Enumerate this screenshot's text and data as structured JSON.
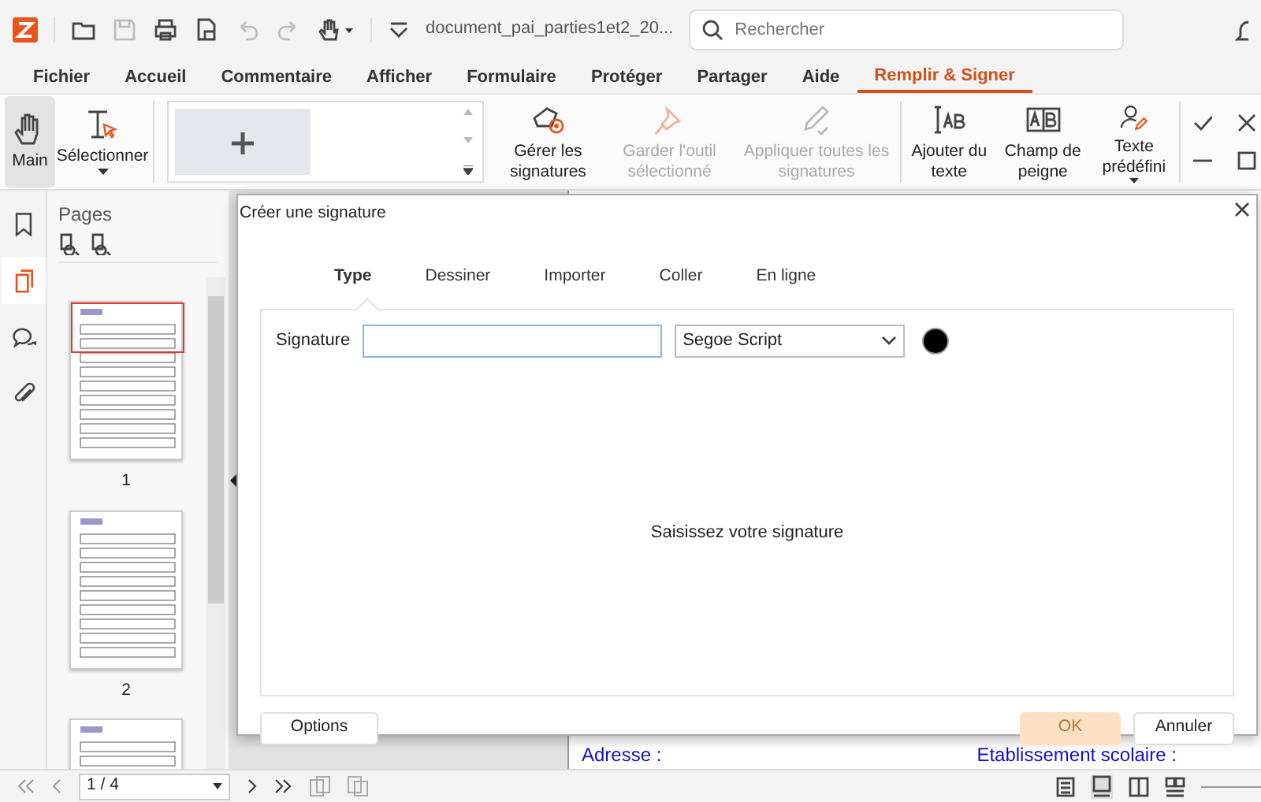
{
  "titlebar": {
    "filename": "document_pai_parties1et2_20...",
    "search": {
      "placeholder": "Rechercher"
    }
  },
  "menu": [
    {
      "label": "Fichier",
      "selected": false
    },
    {
      "label": "Accueil",
      "selected": false
    },
    {
      "label": "Commentaire",
      "selected": false
    },
    {
      "label": "Afficher",
      "selected": false
    },
    {
      "label": "Formulaire",
      "selected": false
    },
    {
      "label": "Protéger",
      "selected": false
    },
    {
      "label": "Partager",
      "selected": false
    },
    {
      "label": "Aide",
      "selected": false
    },
    {
      "label": "Remplir & Signer",
      "selected": true
    }
  ],
  "ribbon": {
    "tools": [
      {
        "kind": "hand",
        "label": "Main",
        "selected": true,
        "dropdown": false
      },
      {
        "kind": "select",
        "label": "Sélectionner",
        "selected": false,
        "dropdown": true
      }
    ],
    "actions": [
      {
        "kind": "manage",
        "label": "Gérer les signatures",
        "disabled": false,
        "dropdown": false
      },
      {
        "kind": "pin",
        "label": "Garder l'outil sélectionné",
        "disabled": true,
        "dropdown": false
      },
      {
        "kind": "apply",
        "label": "Appliquer toutes les signatures",
        "disabled": true,
        "dropdown": false
      },
      {
        "kind": "text",
        "label": "Ajouter du texte",
        "disabled": false,
        "dropdown": false
      },
      {
        "kind": "comb",
        "label": "Champ de peigne",
        "disabled": false,
        "dropdown": false
      },
      {
        "kind": "predefined",
        "label": "Texte prédéfini",
        "disabled": false,
        "dropdown": true
      }
    ]
  },
  "sidebar_tabs": [
    {
      "kind": "bookmark",
      "selected": false
    },
    {
      "kind": "pages",
      "selected": true
    },
    {
      "kind": "comments",
      "selected": false
    },
    {
      "kind": "attachments",
      "selected": false
    }
  ],
  "pages_panel": {
    "title": "Pages",
    "thumbnails": [
      {
        "label": "1",
        "current": true
      },
      {
        "label": "2",
        "current": false
      },
      {
        "current": false
      }
    ]
  },
  "document": {
    "texts": [
      "Adresse :",
      "Etablissement scolaire :"
    ]
  },
  "dialog": {
    "title": "Créer une signature",
    "tabs": [
      {
        "label": "Type",
        "selected": true
      },
      {
        "label": "Dessiner",
        "selected": false
      },
      {
        "label": "Importer",
        "selected": false
      },
      {
        "label": "Coller",
        "selected": false
      },
      {
        "label": "En ligne",
        "selected": false
      }
    ],
    "signature_label": "Signature",
    "font": "Segoe Script",
    "color": "#000000",
    "prompt": "Saisissez votre signature",
    "buttons": [
      {
        "kind": "options",
        "label": "Options",
        "disabled": false
      },
      {
        "kind": "ok",
        "label": "OK",
        "disabled": true
      },
      {
        "kind": "cancel",
        "label": "Annuler",
        "disabled": false
      }
    ]
  },
  "statusbar": {
    "page": "1 / 4"
  }
}
